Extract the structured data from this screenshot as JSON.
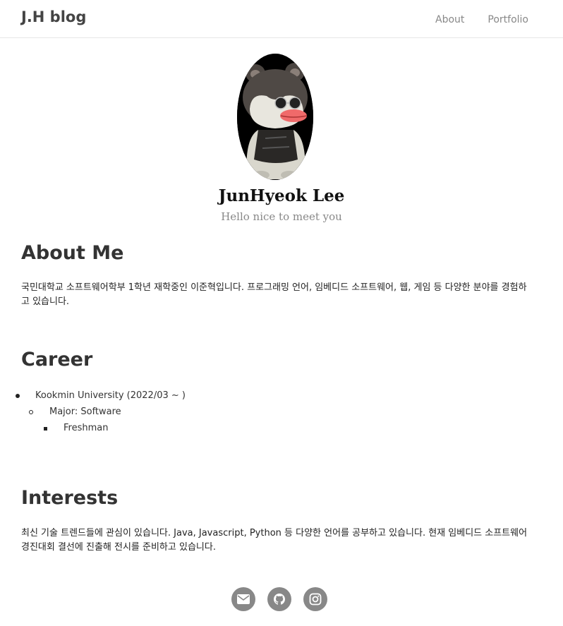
{
  "nav": {
    "brand": "J.H blog",
    "links": [
      "About",
      "Portfolio"
    ]
  },
  "profile": {
    "name": "JunHyeok Lee",
    "tagline": "Hello nice to meet you"
  },
  "about": {
    "heading": "About Me",
    "text": "국민대학교 소프트웨어학부 1학년 재학중인 이준혁입니다. 프로그래밍 언어, 임베디드 소프트웨어, 웹, 게임 등 다양한 분야를 경험하고 있습니다."
  },
  "career": {
    "heading": "Career",
    "school": "Kookmin University (2022/03 ~ )",
    "major": "Major: Software",
    "year": "Freshman"
  },
  "interests": {
    "heading": "Interests",
    "text": "최신 기술 트렌드들에 관심이 있습니다. Java, Javascript, Python 등 다양한 언어를 공부하고 있습니다. 현재 임베디드 소프트웨어 경진대회 결선에 진출해 전시를 준비하고 있습니다."
  },
  "social": [
    "envelope-icon",
    "github-icon",
    "instagram-icon"
  ],
  "colors": {
    "social_bg": "#888888",
    "brand": "#444444"
  }
}
